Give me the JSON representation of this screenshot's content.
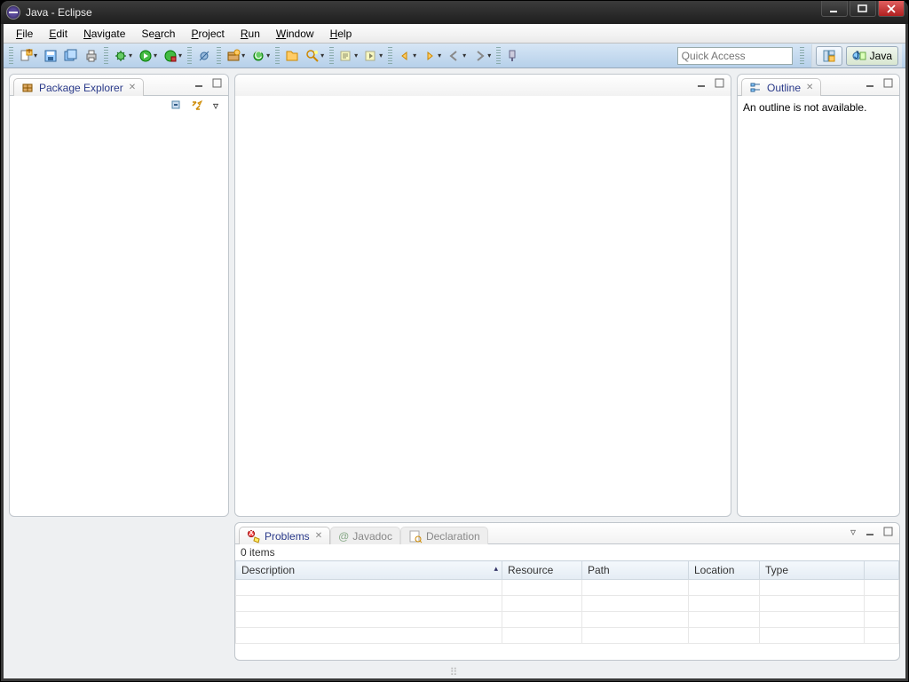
{
  "window": {
    "title": "Java - Eclipse"
  },
  "menu": {
    "file": "File",
    "edit": "Edit",
    "navigate": "Navigate",
    "search": "Search",
    "project": "Project",
    "run": "Run",
    "window": "Window",
    "help": "Help"
  },
  "toolbar": {
    "quick_access_placeholder": "Quick Access",
    "perspective_label": "Java"
  },
  "views": {
    "package_explorer": {
      "title": "Package Explorer"
    },
    "outline": {
      "title": "Outline",
      "empty_msg": "An outline is not available."
    },
    "problems": {
      "tabs": {
        "problems": "Problems",
        "javadoc": "Javadoc",
        "declaration": "Declaration"
      },
      "count": "0 items",
      "cols": {
        "description": "Description",
        "resource": "Resource",
        "path": "Path",
        "location": "Location",
        "type": "Type"
      }
    }
  }
}
